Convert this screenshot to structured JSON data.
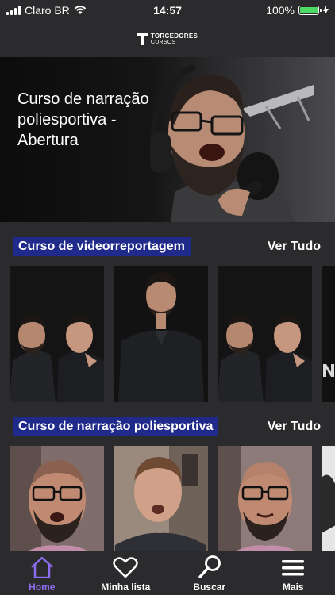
{
  "status_bar": {
    "carrier": "Claro BR",
    "time": "14:57",
    "battery": "100%"
  },
  "header": {
    "logo_line1": "TORCEDORES",
    "logo_line2": "CURSOS"
  },
  "hero": {
    "title": "Curso de narração poliesportiva - Abertura"
  },
  "sections": [
    {
      "title": "Curso de videorreportagem",
      "see_all": "Ver Tudo"
    },
    {
      "title": "Curso de narração poliesportiva",
      "see_all": "Ver Tudo"
    }
  ],
  "tabs": [
    {
      "label": "Home",
      "icon": "home-icon",
      "active": true
    },
    {
      "label": "Minha lista",
      "icon": "heart-icon",
      "active": false
    },
    {
      "label": "Buscar",
      "icon": "search-icon",
      "active": false
    },
    {
      "label": "Mais",
      "icon": "menu-icon",
      "active": false
    }
  ],
  "colors": {
    "accent": "#8c6cf0",
    "section_badge": "#1f2a8a",
    "background": "#2b2b2d",
    "battery": "#4cd964"
  }
}
